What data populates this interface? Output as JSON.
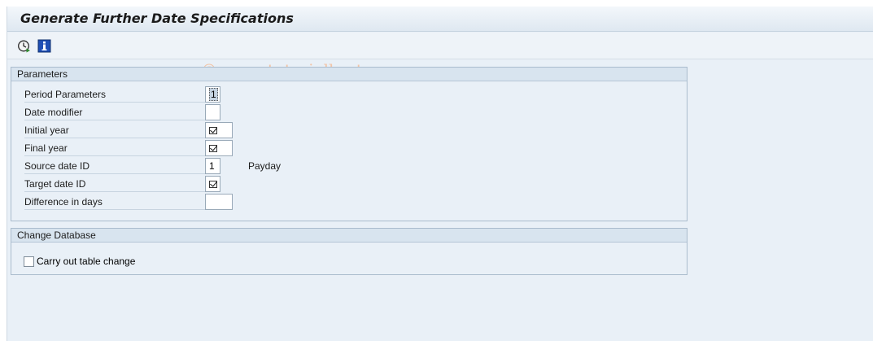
{
  "window": {
    "title": "Generate Further Date Specifications",
    "watermark": "© www.tutorialkart.com"
  },
  "toolbar": {
    "execute_icon": "execute-clock-icon",
    "info_icon": "info-icon"
  },
  "parameters": {
    "heading": "Parameters",
    "rows": [
      {
        "label": "Period Parameters",
        "value": "1"
      },
      {
        "label": "Date modifier",
        "value": ""
      },
      {
        "label": "Initial year",
        "value": "checked"
      },
      {
        "label": "Final year",
        "value": "checked"
      },
      {
        "label": "Source date ID",
        "value": "1",
        "text": "Payday"
      },
      {
        "label": "Target date ID",
        "value": "checked"
      },
      {
        "label": "Difference in days",
        "value": ""
      }
    ]
  },
  "change_db": {
    "heading": "Change Database",
    "checkbox_label": "Carry out table change",
    "checked": false
  },
  "colors": {
    "background": "#e9f0f7",
    "group_header": "#d8e4ef",
    "watermark": "#f2c5a8"
  }
}
